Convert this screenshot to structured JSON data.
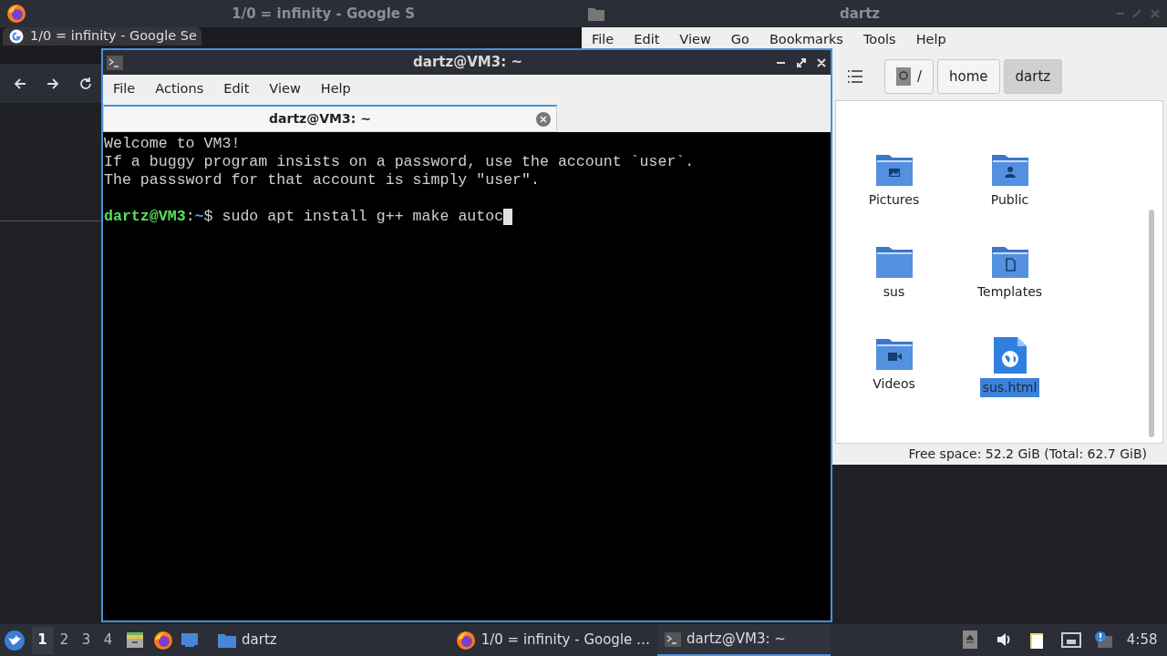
{
  "browser": {
    "title": "1/0 = infinity - Google S",
    "tab": {
      "label": "1/0 = infinity - Google Se"
    }
  },
  "file_manager": {
    "title": "dartz",
    "menu": [
      "File",
      "Edit",
      "View",
      "Go",
      "Bookmarks",
      "Tools",
      "Help"
    ],
    "path": [
      {
        "label": "/",
        "kind": "root",
        "selected": false
      },
      {
        "label": "home",
        "kind": "dir",
        "selected": false
      },
      {
        "label": "dartz",
        "kind": "dir",
        "selected": true
      }
    ],
    "files": [
      {
        "name": "Pictures",
        "kind": "pictures",
        "selected": false
      },
      {
        "name": "Public",
        "kind": "public",
        "selected": false
      },
      {
        "name": "sus",
        "kind": "folder",
        "selected": false
      },
      {
        "name": "Templates",
        "kind": "templates",
        "selected": false
      },
      {
        "name": "Videos",
        "kind": "videos",
        "selected": false
      },
      {
        "name": "sus.html",
        "kind": "html",
        "selected": true
      }
    ],
    "status": "Free space: 52.2 GiB (Total: 62.7 GiB)"
  },
  "terminal": {
    "title": "dartz@VM3: ~",
    "menu": [
      "File",
      "Actions",
      "Edit",
      "View",
      "Help"
    ],
    "tab": {
      "label": "dartz@VM3: ~"
    },
    "lines": [
      {
        "segments": [
          {
            "kind": "plain",
            "text": "Welcome to VM3!"
          }
        ]
      },
      {
        "segments": [
          {
            "kind": "plain",
            "text": "If a buggy program insists on a password, use the account `user`."
          }
        ]
      },
      {
        "segments": [
          {
            "kind": "plain",
            "text": "The passsword for that account is simply \"user\"."
          }
        ]
      },
      {
        "kind": "blank"
      },
      {
        "segments": [
          {
            "kind": "user",
            "text": "dartz@VM3"
          },
          {
            "kind": "plain",
            "text": ":"
          },
          {
            "kind": "path",
            "text": "~"
          },
          {
            "kind": "plain",
            "text": "$ sudo apt install g++ make autoc"
          }
        ],
        "cursor": true
      }
    ]
  },
  "taskbar": {
    "workspaces": [
      {
        "label": "1",
        "selected": true
      },
      {
        "label": "2",
        "selected": false
      },
      {
        "label": "3",
        "selected": false
      },
      {
        "label": "4",
        "selected": false
      }
    ],
    "tasks": [
      {
        "label": "dartz",
        "kind": "folder",
        "selected": false
      },
      {
        "label": "1/0 = infinity - Google …",
        "kind": "browser",
        "selected": false
      },
      {
        "label": "dartz@VM3: ~",
        "kind": "terminal",
        "selected": true
      }
    ],
    "clock": "4:58"
  }
}
